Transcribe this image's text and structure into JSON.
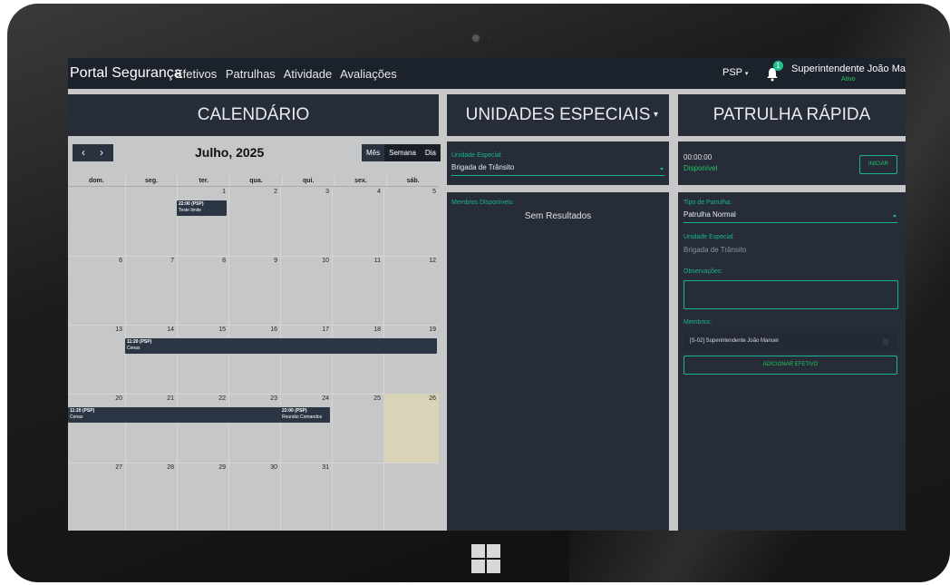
{
  "navbar": {
    "brand": "Portal Segurança",
    "links": [
      "Efetivos",
      "Patrulhas",
      "Atividade",
      "Avaliações"
    ],
    "org_menu": "PSP",
    "notification_count": "1",
    "user_name": "Superintendente João Manuel",
    "user_status": "Ativo"
  },
  "calendar": {
    "header": "CALENDÁRIO",
    "prev_label": "‹",
    "next_label": "›",
    "month_title": "Julho, 2025",
    "views": [
      "Mês",
      "Semana",
      "Dia"
    ],
    "weekdays": [
      "dom.",
      "seg.",
      "ter.",
      "qua.",
      "qui.",
      "sex.",
      "sáb."
    ],
    "weeks": [
      [
        "",
        "",
        "1",
        "2",
        "3",
        "4",
        "5"
      ],
      [
        "6",
        "7",
        "8",
        "9",
        "10",
        "11",
        "12"
      ],
      [
        "13",
        "14",
        "15",
        "16",
        "17",
        "18",
        "19"
      ],
      [
        "20",
        "21",
        "22",
        "23",
        "24",
        "25",
        "26"
      ],
      [
        "27",
        "28",
        "29",
        "30",
        "31",
        "",
        ""
      ]
    ],
    "events": [
      {
        "time": "22:00 (PSP)",
        "title": "Teste limite"
      },
      {
        "time": "11:20 (PSP)",
        "title": "Cenas"
      },
      {
        "time": "11:20 (PSP)",
        "title": "Cenas"
      },
      {
        "time": "22:00 (PSP)",
        "title": "Reunião Comandos"
      }
    ]
  },
  "unidades": {
    "header": "UNIDADES ESPECIAIS",
    "unit_label": "Unidade Especial:",
    "unit_value": "Brigada de Trânsito",
    "members_label": "Membros Disponíveis:",
    "no_results": "Sem Resultados"
  },
  "patrulha": {
    "header": "PATRULHA RÁPIDA",
    "timer": "00:00:00",
    "status": "Disponível",
    "start_button": "INICIAR",
    "type_label": "Tipo de Patrulha:",
    "type_value": "Patrulha Normal",
    "unit_label": "Unidade Especial:",
    "unit_value": "Brigada de Trânsito",
    "obs_label": "Observações:",
    "members_label": "Membros:",
    "member_item": "[S-02] Superintendente João Manuel",
    "add_button": "ADICIONAR EFETIVO"
  }
}
